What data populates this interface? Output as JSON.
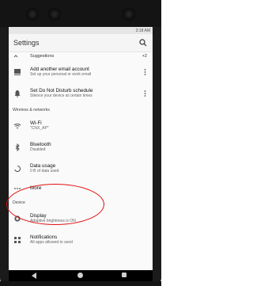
{
  "status_bar": {
    "time": "3:18 AM",
    "left_text": ""
  },
  "app_bar": {
    "title": "Settings"
  },
  "suggestions": {
    "label": "Suggestions",
    "count": "+2"
  },
  "items": [
    {
      "primary": "Add another email account",
      "secondary": "Set up your personal or work email"
    },
    {
      "primary": "Set Do Not Disturb schedule",
      "secondary": "Silence your device at certain times"
    }
  ],
  "wireless_section": {
    "label": "Wireless & networks"
  },
  "wifi": {
    "primary": "Wi-Fi",
    "secondary": "\"CNX_AP\""
  },
  "bluetooth": {
    "primary": "Bluetooth",
    "secondary": "Disabled"
  },
  "data_usage": {
    "primary": "Data usage",
    "secondary": "0 B of data used"
  },
  "more": {
    "primary": "More"
  },
  "device_section": {
    "label": "Device"
  },
  "display": {
    "primary": "Display",
    "secondary": "Adaptive brightness is ON"
  },
  "notifications": {
    "primary": "Notifications",
    "secondary": "All apps allowed to send"
  },
  "colors": {
    "annotation_circle": "#e11111"
  }
}
